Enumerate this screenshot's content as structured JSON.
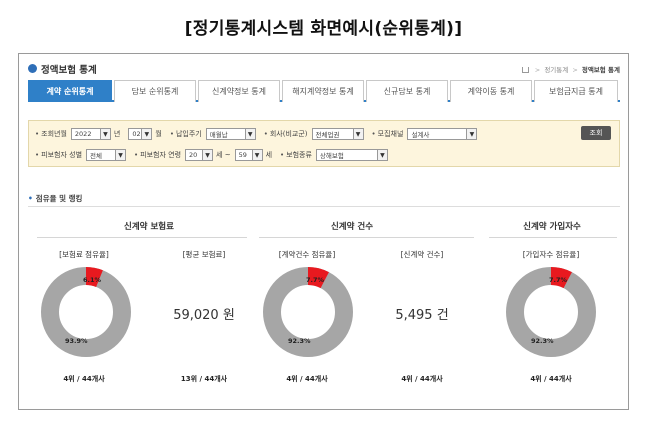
{
  "caption": "[정기통계시스템 화면예시(순위통계)]",
  "header": {
    "title": "정액보험 통계",
    "breadcrumb": [
      "정기통계",
      "정액보험 통계"
    ]
  },
  "tabs": [
    {
      "label": "계약 순위통계",
      "active": true
    },
    {
      "label": "담보 순위통계",
      "active": false
    },
    {
      "label": "신계약정보 통계",
      "active": false
    },
    {
      "label": "해지계약정보 통계",
      "active": false
    },
    {
      "label": "신규담보 통계",
      "active": false
    },
    {
      "label": "계약이동 통계",
      "active": false
    },
    {
      "label": "보험금지급 통계",
      "active": false
    }
  ],
  "filters": {
    "row1": {
      "year_label": "조회년월",
      "year_value": "2022",
      "year_unit": "년",
      "month_value": "02",
      "month_unit": "월",
      "payment_label": "납입주기",
      "payment_value": "매월납",
      "company_label": "회사(비교군)",
      "company_value": "전체업권",
      "channel_label": "모집채널",
      "channel_value": "설계사"
    },
    "row2": {
      "gender_label": "피보험자 성별",
      "gender_value": "전체",
      "age_label": "피보험자 연령",
      "age_from": "20",
      "age_unit1": "세 ~",
      "age_to": "59",
      "age_unit2": "세",
      "type_label": "보험종류",
      "type_value": "상해보험"
    },
    "search_label": "조회"
  },
  "section_title": "점유율 및 랭킹",
  "groups": [
    {
      "title": "신계약 보험료",
      "items": [
        {
          "label": "[보험료 점유율]",
          "kind": "donut",
          "share_pct": 6.1,
          "share_text": "6.1%",
          "rest_text": "93.9%",
          "rank": "4위 / 44개사"
        },
        {
          "label": "[평균 보험료]",
          "kind": "value",
          "value": "59,020 원",
          "rank": "13위 / 44개사"
        }
      ]
    },
    {
      "title": "신계약 건수",
      "items": [
        {
          "label": "[계약건수 점유율]",
          "kind": "donut",
          "share_pct": 7.7,
          "share_text": "7.7%",
          "rest_text": "92.3%",
          "rank": "4위 / 44개사"
        },
        {
          "label": "[신계약 건수]",
          "kind": "value",
          "value": "5,495 건",
          "rank": "4위 / 44개사"
        }
      ]
    },
    {
      "title": "신계약 가입자수",
      "items": [
        {
          "label": "[가입자수 점유율]",
          "kind": "donut",
          "share_pct": 7.7,
          "share_text": "7.7%",
          "rest_text": "92.3%",
          "rank": "4위 / 44개사"
        }
      ]
    }
  ],
  "colors": {
    "accent": "#2f80c8",
    "share": "#e8191f",
    "rest": "#a6a6a6",
    "filter_bg": "#fdf5dd"
  }
}
